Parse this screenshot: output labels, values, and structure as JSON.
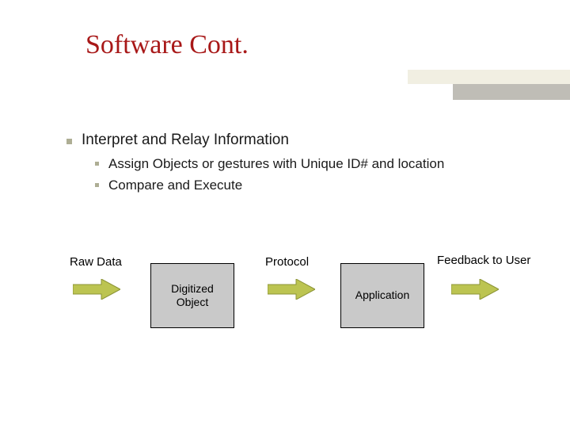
{
  "title": "Software Cont.",
  "bullets": {
    "main": "Interpret and Relay Information",
    "sub1": "Assign Objects or gestures with Unique ID# and location",
    "sub2": "Compare and Execute"
  },
  "flow": {
    "label1": "Raw Data",
    "box1": "Digitized Object",
    "label2": "Protocol",
    "box2": "Application",
    "label3": "Feedback to User"
  }
}
